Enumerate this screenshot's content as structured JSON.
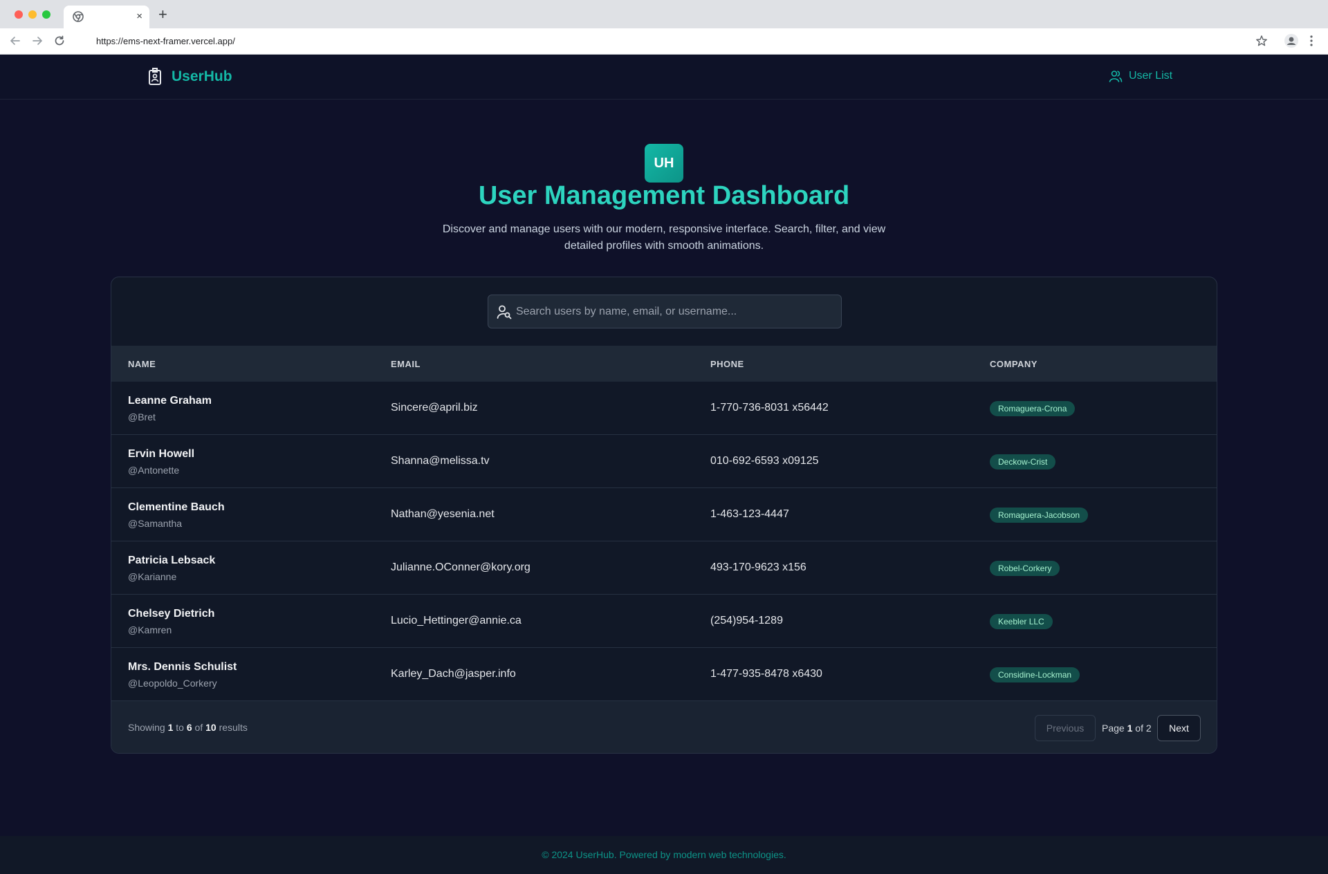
{
  "browser": {
    "url": "https://ems-next-framer.vercel.app/",
    "new_tab": "+",
    "tab_close": "×"
  },
  "header": {
    "brand": "UserHub",
    "nav_link": "User List"
  },
  "hero": {
    "badge": "UH",
    "title": "User Management Dashboard",
    "subtitle": "Discover and manage users with our modern, responsive interface. Search, filter, and view detailed profiles with smooth animations."
  },
  "search": {
    "placeholder": "Search users by name, email, or username..."
  },
  "table": {
    "columns": [
      "NAME",
      "EMAIL",
      "PHONE",
      "COMPANY"
    ],
    "rows": [
      {
        "name": "Leanne Graham",
        "username": "@Bret",
        "email": "Sincere@april.biz",
        "phone": "1-770-736-8031 x56442",
        "company": "Romaguera-Crona"
      },
      {
        "name": "Ervin Howell",
        "username": "@Antonette",
        "email": "Shanna@melissa.tv",
        "phone": "010-692-6593 x09125",
        "company": "Deckow-Crist"
      },
      {
        "name": "Clementine Bauch",
        "username": "@Samantha",
        "email": "Nathan@yesenia.net",
        "phone": "1-463-123-4447",
        "company": "Romaguera-Jacobson"
      },
      {
        "name": "Patricia Lebsack",
        "username": "@Karianne",
        "email": "Julianne.OConner@kory.org",
        "phone": "493-170-9623 x156",
        "company": "Robel-Corkery"
      },
      {
        "name": "Chelsey Dietrich",
        "username": "@Kamren",
        "email": "Lucio_Hettinger@annie.ca",
        "phone": "(254)954-1289",
        "company": "Keebler LLC"
      },
      {
        "name": "Mrs. Dennis Schulist",
        "username": "@Leopoldo_Corkery",
        "email": "Karley_Dach@jasper.info",
        "phone": "1-477-935-8478 x6430",
        "company": "Considine-Lockman"
      }
    ]
  },
  "pagination": {
    "showing_prefix": "Showing",
    "from": "1",
    "to_word": "to",
    "to": "6",
    "of_word": "of",
    "total": "10",
    "results_word": "results",
    "previous": "Previous",
    "next": "Next",
    "page_word": "Page",
    "page_current": "1",
    "page_of": "of 2"
  },
  "footer": {
    "text": "© 2024 UserHub. Powered by modern web technologies."
  },
  "colors": {
    "accent": "#14b8a6",
    "background": "#0f1129",
    "card": "#111827",
    "badge_bg": "#134e4a"
  }
}
